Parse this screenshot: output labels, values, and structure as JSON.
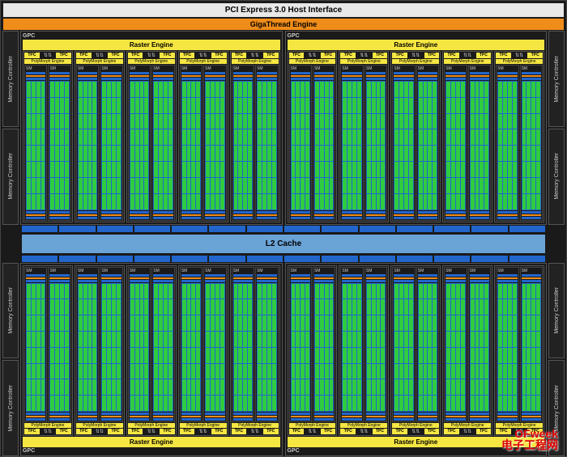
{
  "header": {
    "pci": "PCI Express 3.0 Host Interface",
    "giga": "GigaThread Engine"
  },
  "labels": {
    "gpc": "GPC",
    "raster": "Raster Engine",
    "tpc": "TPC",
    "polymorph": "PolyMorph Engine",
    "sm": "SM",
    "mc": "Memory Controller",
    "l2": "L2 Cache"
  },
  "layout": {
    "gpc_count": 4,
    "tpc_per_gpc": 5,
    "sm_per_tpc": 2,
    "cores_per_sm_grid": [
      4,
      8
    ],
    "memory_controllers_per_side": 4
  },
  "colors": {
    "raster_yellow": "#f5e642",
    "orange": "#f08c1a",
    "blue": "#2266cc",
    "core_green": "#2ecc40",
    "l2_blue": "#6aa3d6"
  },
  "watermark": {
    "brand": "OFweek",
    "text": "电子工程网"
  }
}
